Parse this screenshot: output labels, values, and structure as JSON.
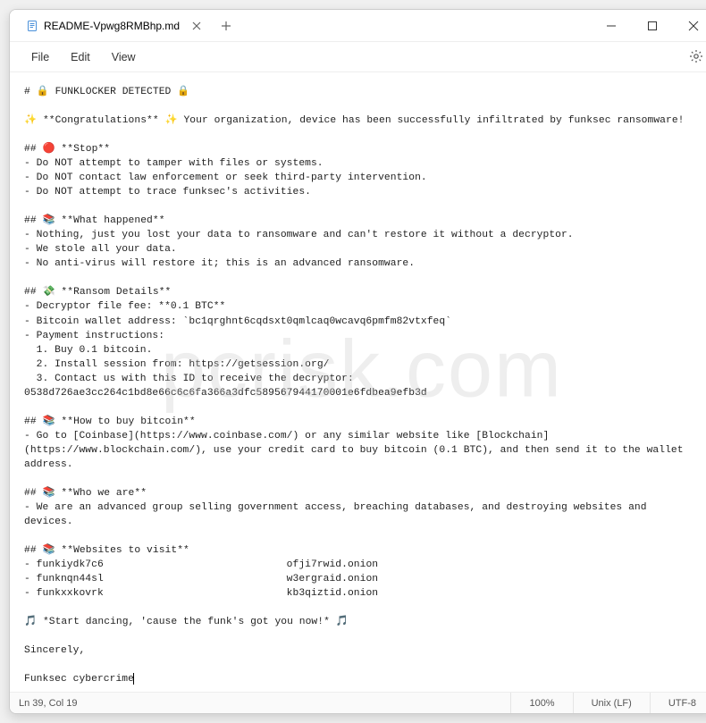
{
  "tab": {
    "title": "README-Vpwg8RMBhp.md"
  },
  "menu": {
    "file": "File",
    "edit": "Edit",
    "view": "View"
  },
  "doc": {
    "l1": "# 🔒 FUNKLOCKER DETECTED 🔒",
    "l2": "✨ **Congratulations** ✨ Your organization, device has been successfully infiltrated by funksec ransomware!",
    "h_stop": "## 🔴 **Stop**",
    "stop1": "- Do NOT attempt to tamper with files or systems.",
    "stop2": "- Do NOT contact law enforcement or seek third-party intervention.",
    "stop3": "- Do NOT attempt to trace funksec's activities.",
    "h_what": "## 📚 **What happened**",
    "what1": "- Nothing, just you lost your data to ransomware and can't restore it without a decryptor.",
    "what2": "- We stole all your data.",
    "what3": "- No anti-virus will restore it; this is an advanced ransomware.",
    "h_ransom": "## 💸 **Ransom Details**",
    "r1": "- Decryptor file fee: **0.1 BTC**",
    "r2": "- Bitcoin wallet address: `bc1qrghnt6cqdsxt0qmlcaq0wcavq6pmfm82vtxfeq`",
    "r3": "- Payment instructions:",
    "r4": "  1. Buy 0.1 bitcoin.",
    "r5": "  2. Install session from: https://getsession.org/",
    "r6": "  3. Contact us with this ID to receive the decryptor: 0538d726ae3cc264c1bd8e66c6c6fa366a3dfc589567944170001e6fdbea9efb3d",
    "h_buy": "## 📚 **How to buy bitcoin**",
    "buy1": "- Go to [Coinbase](https://www.coinbase.com/) or any similar website like [Blockchain](https://www.blockchain.com/), use your credit card to buy bitcoin (0.1 BTC), and then send it to the wallet address.",
    "h_who": "## 📚 **Who we are**",
    "who1": "- We are an advanced group selling government access, breaching databases, and destroying websites and devices.",
    "h_web": "## 📚 **Websites to visit**",
    "site1_a": "- funkiydk7c6",
    "site1_b": "                              ",
    "site1_c": "ofji7rwid.onion",
    "site2_a": "- funknqn44sl",
    "site2_b": "                              ",
    "site2_c": "w3ergraid.onion",
    "site3_a": "- funkxxkovrk",
    "site3_b": "                              ",
    "site3_c": "kb3qiztid.onion",
    "dance": "🎵 *Start dancing, 'cause the funk's got you now!* 🎵",
    "sincerely": "Sincerely,",
    "sig": "Funksec cybercrime"
  },
  "status": {
    "pos": "Ln 39, Col 19",
    "zoom": "100%",
    "eol": "Unix (LF)",
    "enc": "UTF-8"
  },
  "watermark": "pcrisk.com"
}
